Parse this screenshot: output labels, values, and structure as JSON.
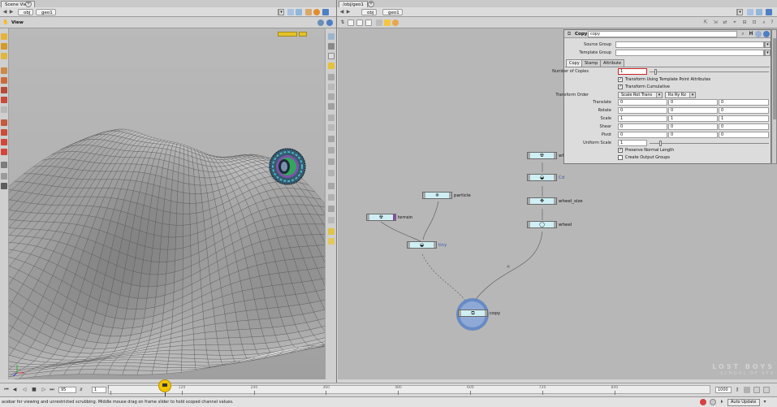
{
  "left_pane": {
    "tab_label": "Scene View",
    "path": [
      "obj",
      "geo1"
    ],
    "view_label": "View"
  },
  "right_pane": {
    "tab_label": "/obj/geo1",
    "path": [
      "obj",
      "geo1"
    ]
  },
  "nodes": [
    {
      "id": "node-wheel-top",
      "label": "wh",
      "glyph": "☢"
    },
    {
      "id": "node-cd",
      "label": "Cd",
      "glyph": "◒"
    },
    {
      "id": "node-particle",
      "label": "particle",
      "glyph": "❈"
    },
    {
      "id": "node-wheel-size",
      "label": "wheel_size",
      "glyph": "✥"
    },
    {
      "id": "node-terrain",
      "label": "terrain",
      "glyph": "☢"
    },
    {
      "id": "node-wheel",
      "label": "wheel",
      "glyph": "◯"
    },
    {
      "id": "node-tiny",
      "label": "tiny",
      "glyph": "◒"
    },
    {
      "id": "node-copy",
      "label": "copy",
      "glyph": "⧉"
    }
  ],
  "params": {
    "node_type": "Copy",
    "node_name": "copy",
    "source_group_label": "Source Group",
    "template_group_label": "Template Group",
    "tabs": [
      "Copy",
      "Stamp",
      "Attribute"
    ],
    "number_of_copies_label": "Number of Copies",
    "number_of_copies": "1",
    "transform_template_label": "Transform Using Template Point Attributes",
    "transform_cumulative_label": "Transform Cumulative",
    "transform_order_label": "Transform Order",
    "transform_order_value": "Scale Rot Trans",
    "rotate_order_value": "Rx Ry Rz",
    "rows": [
      {
        "label": "Translate",
        "values": [
          "0",
          "0",
          "0"
        ]
      },
      {
        "label": "Rotate",
        "values": [
          "0",
          "0",
          "0"
        ]
      },
      {
        "label": "Scale",
        "values": [
          "1",
          "1",
          "1"
        ]
      },
      {
        "label": "Shear",
        "values": [
          "0",
          "0",
          "0"
        ]
      },
      {
        "label": "Pivot",
        "values": [
          "0",
          "0",
          "0"
        ]
      }
    ],
    "uniform_scale_label": "Uniform Scale",
    "uniform_scale": "1",
    "preserve_normal_label": "Preserve Normal Length",
    "create_output_groups_label": "Create Output Groups"
  },
  "timeline": {
    "current_frame": "95",
    "step": "1",
    "ticks": [
      "1",
      "120",
      "240",
      "360",
      "480",
      "600",
      "720",
      "840"
    ],
    "end_frame": "1000",
    "auto_update": "Auto Update"
  },
  "status": {
    "message": "acebar for viewing and unrestricted scrubbing. Middle mouse drag on frame slider to hold scoped channel values."
  },
  "watermark": {
    "line1": "LOST BOYS",
    "line2": "SCHOOL OF VFX"
  },
  "colors": {
    "node_fill": "#cfeff4",
    "copy_highlight": "#5b83c7",
    "accent_yellow": "#f0c400"
  }
}
